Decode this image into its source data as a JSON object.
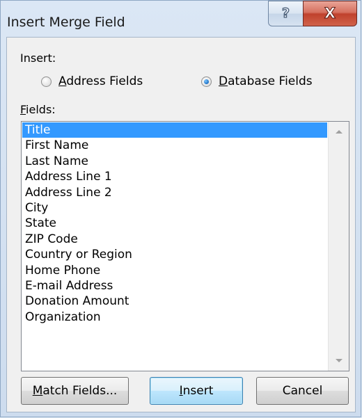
{
  "window": {
    "title": "Insert Merge Field"
  },
  "caption": {
    "help_glyph": "?",
    "close_glyph": "X"
  },
  "insert": {
    "label": "Insert:",
    "options": [
      {
        "underline": "A",
        "rest": "ddress Fields",
        "checked": false
      },
      {
        "underline": "D",
        "rest": "atabase Fields",
        "checked": true
      }
    ]
  },
  "fields": {
    "label_underline": "F",
    "label_rest": "ields:",
    "items": [
      "Title",
      "First Name",
      "Last Name",
      "Address Line 1",
      "Address Line 2",
      "City",
      "State",
      "ZIP Code",
      "Country or Region",
      "Home Phone",
      "E-mail Address",
      "Donation Amount",
      "Organization"
    ],
    "selected_index": 0
  },
  "buttons": {
    "match": {
      "underline": "M",
      "rest": "atch Fields..."
    },
    "insert": {
      "underline": "I",
      "rest": "nsert"
    },
    "cancel": {
      "label": "Cancel"
    }
  },
  "colors": {
    "selection": "#3399ff",
    "close_button": "#c0412d",
    "title_bar": "#dbe7f5"
  }
}
